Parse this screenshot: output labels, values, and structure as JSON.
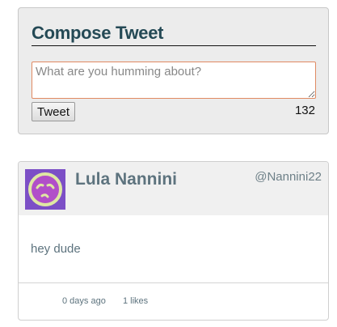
{
  "compose": {
    "title": "Compose Tweet",
    "placeholder": "What are you humming about?",
    "value": "",
    "button_label": "Tweet",
    "char_count": "132"
  },
  "tweets": [
    {
      "name": "Lula Nannini",
      "handle": "@Nannini22",
      "avatar_icon": "sad-face-icon",
      "text": "hey dude",
      "time": "0 days ago",
      "likes": "1 likes"
    }
  ],
  "colors": {
    "accent": "#e08a62",
    "title": "#244955",
    "muted": "#5d737e",
    "avatar_bg": "#7c4fc6"
  }
}
